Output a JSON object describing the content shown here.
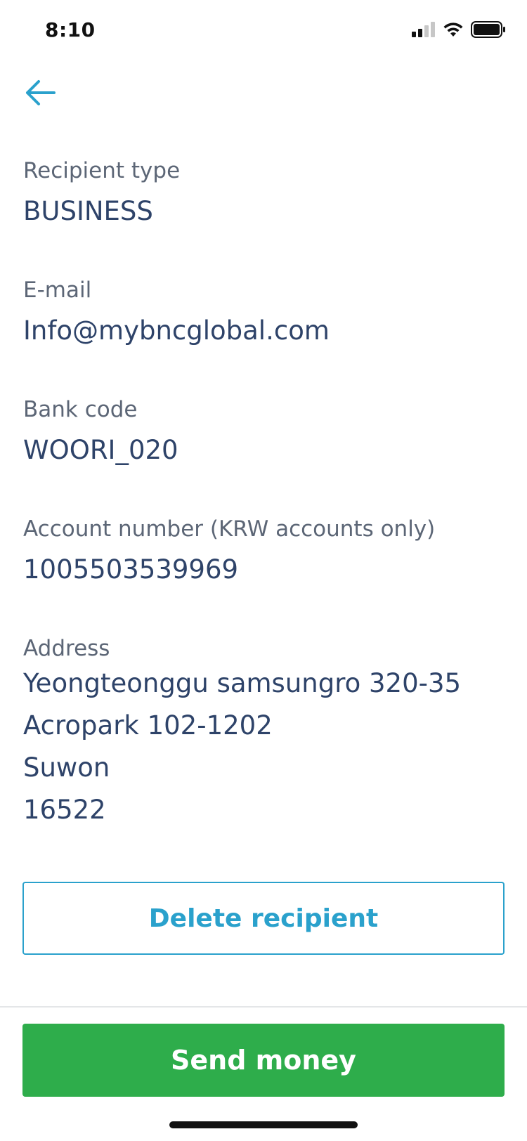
{
  "status_bar": {
    "time": "8:10"
  },
  "header": {
    "back_icon": "arrow-left-icon"
  },
  "details": {
    "recipient_type": {
      "label": "Recipient type",
      "value": "BUSINESS"
    },
    "email": {
      "label": "E-mail",
      "value": "Info@mybncglobal.com"
    },
    "bank_code": {
      "label": "Bank code",
      "value": "WOORI_020"
    },
    "account_number": {
      "label": "Account number (KRW accounts only)",
      "value": "1005503539969"
    },
    "address": {
      "label": "Address",
      "lines": [
        "Yeongteonggu samsungro 320-35",
        "Acropark 102-1202",
        "Suwon",
        "16522"
      ]
    }
  },
  "actions": {
    "delete_label": "Delete recipient",
    "send_label": "Send money"
  },
  "colors": {
    "accent": "#2aa1cc",
    "primary_button": "#2ead4b",
    "value_text": "#2e4369",
    "label_text": "#5c6676"
  }
}
